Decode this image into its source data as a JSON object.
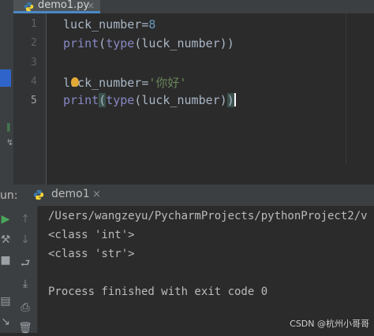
{
  "editor": {
    "tab_name": "demo1.py",
    "tab_close": "×",
    "line_numbers": [
      "1",
      "2",
      "3",
      "4",
      "5"
    ],
    "lines": {
      "l1_var": "luck_number",
      "l1_eq": "=",
      "l1_val": "8",
      "l2_fn": "print",
      "l2_rest1": "(",
      "l2_fn2": "type",
      "l2_rest2": "(luck_number))",
      "l4_var": "luck_number",
      "l4_eq": "=",
      "l4_val": "'你好'",
      "l5_fn": "print",
      "l5_open": "(",
      "l5_fn2": "type",
      "l5_rest": "(luck_number)",
      "l5_close": ")"
    }
  },
  "run_panel": {
    "label": "un:",
    "tab_name": "demo1",
    "tab_close": "×",
    "output": [
      "/Users/wangzeyu/PycharmProjects/pythonProject2/v",
      "<class 'int'>",
      "<class 'str'>",
      "",
      "Process finished with exit code 0"
    ]
  },
  "watermark": "CSDN @杭州小哥哥",
  "colors": {
    "background": "#2b2b2b",
    "number": "#6897bb",
    "string": "#6a8759",
    "builtin": "#8888c6",
    "accent": "#4a88c7"
  },
  "icons": [
    "python-file-icon",
    "close-icon",
    "run-icon",
    "wrench-icon",
    "arrow-up-icon",
    "arrow-down-icon",
    "soft-wrap-icon",
    "scroll-to-end-icon",
    "print-icon",
    "trash-icon"
  ]
}
